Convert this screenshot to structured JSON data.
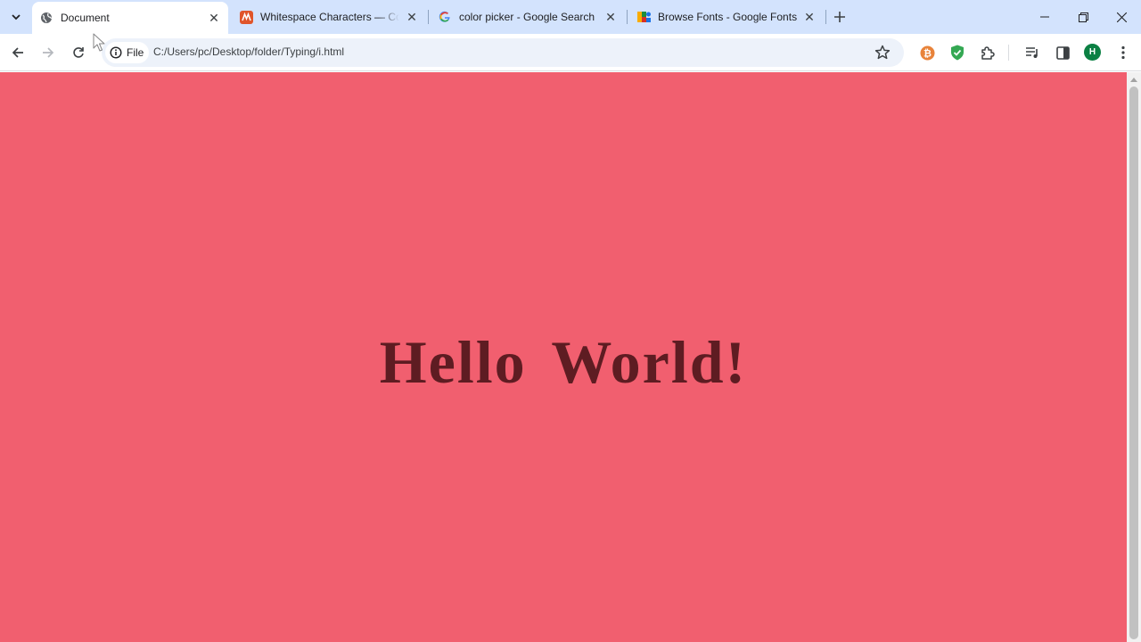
{
  "browser": {
    "tabs": [
      {
        "title": "Document",
        "favicon": "globe-icon",
        "active": true
      },
      {
        "title": "Whitespace Characters — Copy",
        "favicon": "whitespace-favicon-icon",
        "active": false
      },
      {
        "title": "color picker - Google Search",
        "favicon": "google-g-icon",
        "active": false
      },
      {
        "title": "Browse Fonts - Google Fonts",
        "favicon": "google-fonts-icon",
        "active": false
      }
    ],
    "address": {
      "chip_label": "File",
      "url": "C:/Users/pc/Desktop/folder/Typing/i.html"
    },
    "profile_initial": "H",
    "extensions": [
      "bitcoin-extension-icon",
      "shield-extension-icon",
      "puzzle-extensions-icon",
      "media-queue-icon",
      "side-panel-icon"
    ]
  },
  "page": {
    "heading": "Hello World!",
    "background_color": "#f15f6f",
    "heading_color": "#5e1c22"
  },
  "colors": {
    "tabstrip": "#d3e3fd",
    "omnibox": "#edf2fa",
    "accent_avatar": "#0b8043"
  }
}
